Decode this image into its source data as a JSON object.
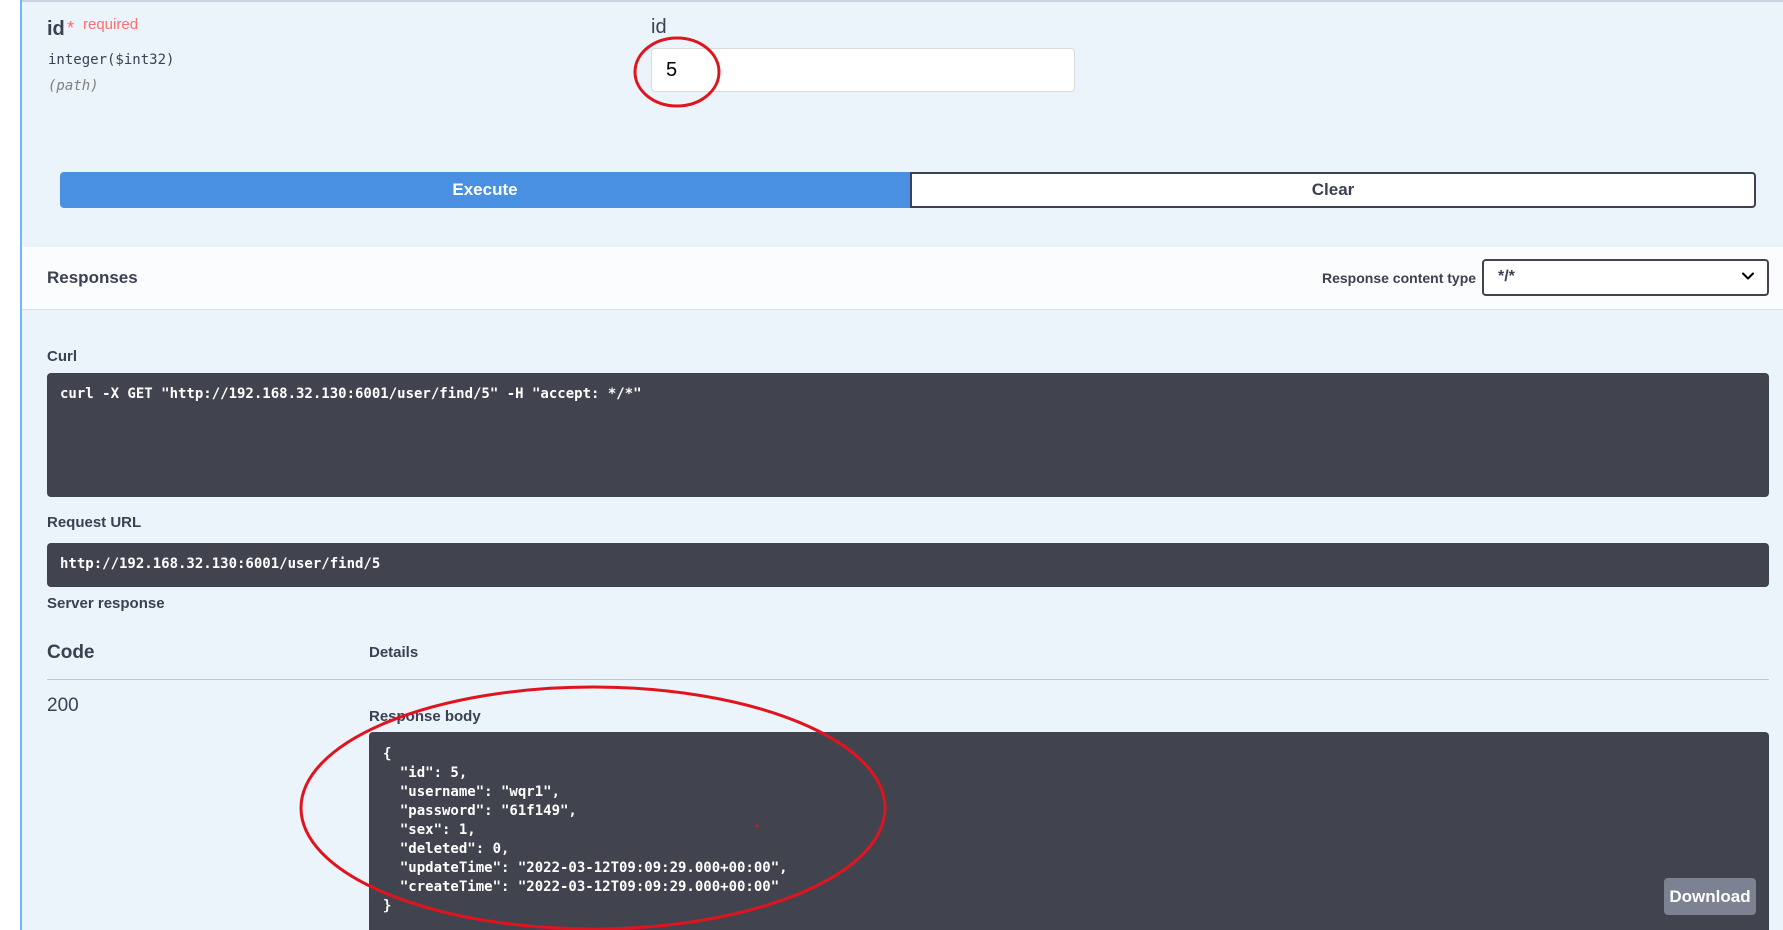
{
  "parameter": {
    "name": "id",
    "required_star": "*",
    "required_label": "required",
    "type": "integer($int32)",
    "in": "(path)",
    "field_label": "id",
    "value": "5"
  },
  "actions": {
    "execute_label": "Execute",
    "clear_label": "Clear"
  },
  "responses": {
    "title": "Responses",
    "content_type_label": "Response content type",
    "content_type_value": "*/*"
  },
  "curl": {
    "label": "Curl",
    "command": "curl -X GET \"http://192.168.32.130:6001/user/find/5\" -H \"accept: */*\""
  },
  "request_url": {
    "label": "Request URL",
    "value": "http://192.168.32.130:6001/user/find/5"
  },
  "server_response": {
    "label": "Server response",
    "code_header": "Code",
    "details_header": "Details",
    "status_code": "200",
    "body_label": "Response body",
    "body_lines": [
      "{",
      "  \"id\": 5,",
      "  \"username\": \"wqr1\",",
      "  \"password\": \"61f149\",",
      "  \"sex\": 1,",
      "  \"deleted\": 0,",
      "  \"updateTime\": \"2022-03-12T09:09:29.000+00:00\",",
      "  \"createTime\": \"2022-03-12T09:09:29.000+00:00\"",
      "}"
    ],
    "download_label": "Download"
  },
  "colors": {
    "execute": "#4990e2",
    "code_background": "#41444e",
    "annotation": "#e0141e",
    "required": "#ff6f6f"
  },
  "icons": {
    "select_arrow": "chevron-down-icon"
  }
}
